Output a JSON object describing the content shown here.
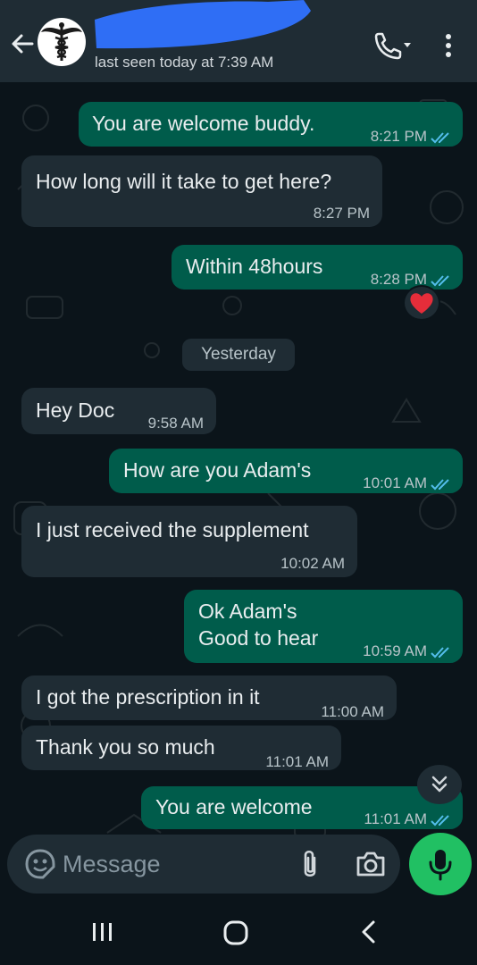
{
  "header": {
    "last_seen": "last seen today at 7:39 AM",
    "back_icon": "arrow-left-icon",
    "avatar_icon": "caduceus-icon",
    "call_icon": "phone-dropdown-icon",
    "menu_icon": "vertical-dots-icon"
  },
  "chat": {
    "day_separator": "Yesterday",
    "messages": [
      {
        "direction": "outgoing",
        "text": "You are welcome buddy.",
        "time": "8:21 PM",
        "status": "read"
      },
      {
        "direction": "incoming",
        "text": "How long will it take to get here?",
        "time": "8:27 PM"
      },
      {
        "direction": "outgoing",
        "text": "Within 48hours",
        "time": "8:28 PM",
        "status": "read",
        "reaction": "red-heart-icon"
      },
      {
        "direction": "incoming",
        "text": "Hey Doc",
        "time": "9:58 AM"
      },
      {
        "direction": "outgoing",
        "text": "How are you Adam's",
        "time": "10:01 AM",
        "status": "read"
      },
      {
        "direction": "incoming",
        "text": "I just received the supplement",
        "time": "10:02 AM"
      },
      {
        "direction": "outgoing",
        "text": "Ok Adam's\nGood to hear",
        "time": "10:59 AM",
        "status": "read"
      },
      {
        "direction": "incoming",
        "text": "I got the prescription in it",
        "time": "11:00 AM"
      },
      {
        "direction": "incoming",
        "text": "Thank you so much",
        "time": "11:01 AM"
      },
      {
        "direction": "outgoing",
        "text": "You are welcome",
        "time": "11:01 AM",
        "status": "read"
      }
    ]
  },
  "composer": {
    "placeholder": "Message",
    "emoji_icon": "sticker-icon",
    "attach_icon": "paperclip-icon",
    "camera_icon": "camera-icon",
    "mic_icon": "microphone-icon"
  },
  "colors": {
    "header_bg": "#1f2c34",
    "chat_bg": "#0b141a",
    "outgoing_bubble": "#005c4b",
    "incoming_bubble": "#1f2c34",
    "read_ticks": "#53bdeb",
    "accent_green": "#21c063",
    "redaction": "#2f6ef5"
  }
}
